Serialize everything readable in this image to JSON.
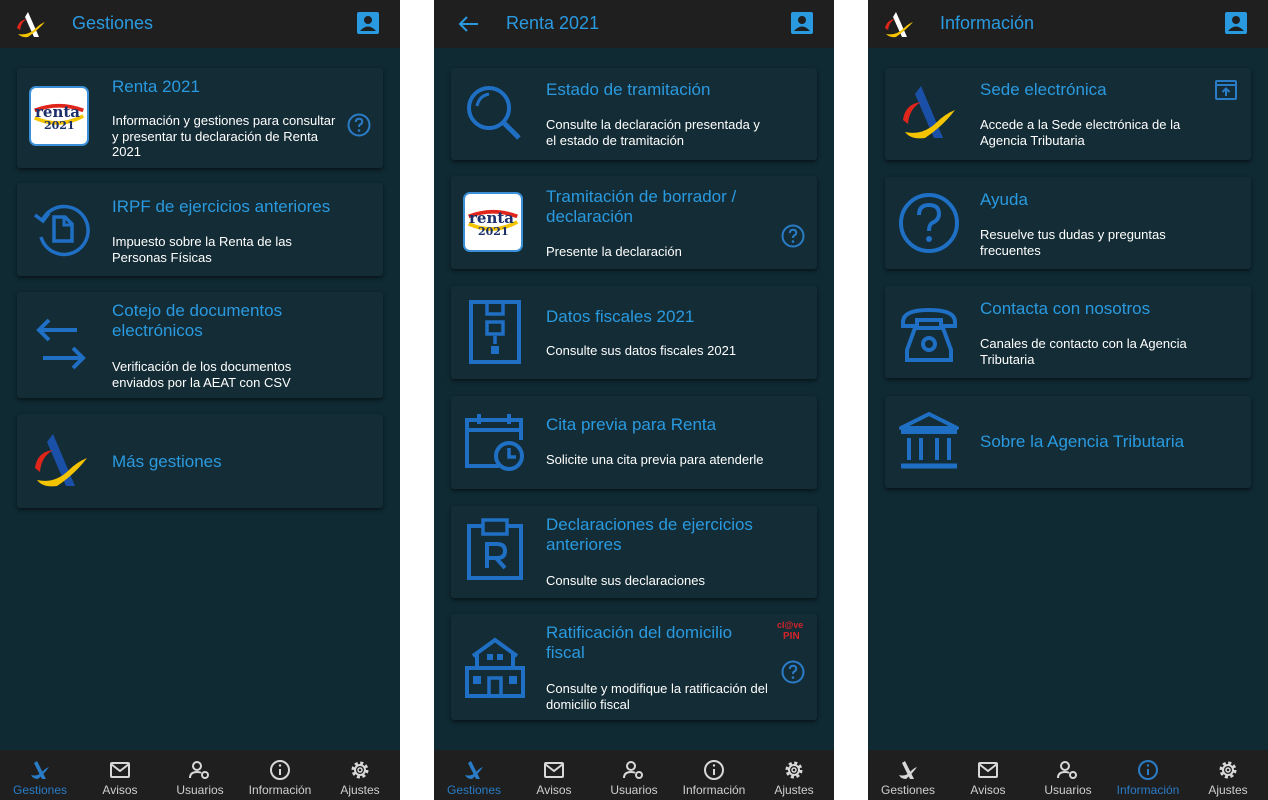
{
  "colors": {
    "accent": "#2a9ae0",
    "background": "#0f2a33",
    "card": "#142c35",
    "bar": "#1f1f1f",
    "nav_active": "#2a7cc7",
    "logo_red": "#e0261b",
    "logo_yellow": "#f5c400",
    "logo_blue": "#1b50a8"
  },
  "nav": {
    "gestiones": "Gestiones",
    "avisos": "Avisos",
    "usuarios": "Usuarios",
    "informacion": "Información",
    "ajustes": "Ajustes"
  },
  "renta_logo": {
    "word": "renta",
    "year": "2021"
  },
  "screen_gestiones": {
    "title": "Gestiones",
    "cards": [
      {
        "title": "Renta 2021",
        "desc": "Información y gestiones para consultar y presentar tu declaración de Renta 2021",
        "icon": "renta-2021-logo"
      },
      {
        "title": "IRPF de ejercicios anteriores",
        "desc": "Impuesto sobre la Renta de las Personas Físicas",
        "icon": "history-document-icon"
      },
      {
        "title": "Cotejo de documentos electrónicos",
        "desc": "Verificación de los documentos enviados por la AEAT con CSV",
        "icon": "swap-arrows-icon"
      },
      {
        "title": "Más gestiones",
        "icon": "aeat-logo"
      }
    ],
    "active_tab": "gestiones"
  },
  "screen_renta": {
    "title": "Renta 2021",
    "cards": [
      {
        "title": "Estado de tramitación",
        "desc": "Consulte la declaración presentada y el estado de tramitación",
        "icon": "magnifier-icon"
      },
      {
        "title": "Tramitación de borrador / declaración",
        "desc": "Presente la declaración",
        "icon": "renta-2021-logo"
      },
      {
        "title": "Datos fiscales 2021",
        "desc": "Consulte sus datos fiscales 2021",
        "icon": "fiscal-data-icon"
      },
      {
        "title": "Cita previa para Renta",
        "desc": "Solicite una cita previa para atenderle",
        "icon": "calendar-clock-icon"
      },
      {
        "title": "Declaraciones de ejercicios anteriores",
        "desc": "Consulte sus declaraciones",
        "icon": "clipboard-r-icon"
      },
      {
        "title": "Ratificación del domicilio fiscal",
        "desc": "Consulte y modifique la ratificación del domicilio fiscal",
        "icon": "building-icon"
      }
    ],
    "clave_badge": {
      "line1": "cl@ve",
      "line2": "PIN"
    },
    "active_tab": "gestiones"
  },
  "screen_info": {
    "title": "Información",
    "cards": [
      {
        "title": "Sede electrónica",
        "desc": "Accede a la Sede electrónica de la Agencia Tributaria",
        "icon": "aeat-logo"
      },
      {
        "title": "Ayuda",
        "desc": "Resuelve tus dudas y preguntas frecuentes",
        "icon": "question-circle-icon"
      },
      {
        "title": "Contacta con nosotros",
        "desc": "Canales de contacto con la Agencia Tributaria",
        "icon": "telephone-icon"
      },
      {
        "title": "Sobre la Agencia Tributaria",
        "icon": "institution-icon"
      }
    ],
    "active_tab": "informacion"
  }
}
